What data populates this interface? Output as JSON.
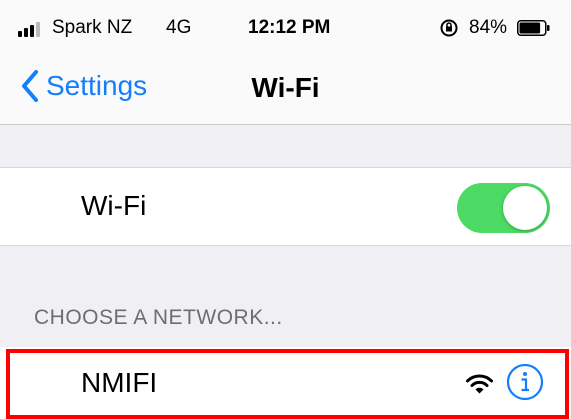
{
  "status_bar": {
    "carrier": "Spark NZ",
    "network_type": "4G",
    "time": "12:12 PM",
    "battery_percent": "84%",
    "battery_level": 0.84,
    "signal_bars": 3
  },
  "nav": {
    "back_label": "Settings",
    "title": "Wi-Fi"
  },
  "wifi_toggle": {
    "label": "Wi-Fi",
    "enabled": true
  },
  "networks_section": {
    "header": "CHOOSE A NETWORK...",
    "networks": [
      {
        "name": "NMIFI",
        "highlighted": true
      }
    ]
  },
  "colors": {
    "accent": "#147efb",
    "toggle_on": "#4cd964",
    "highlight": "#ff0000",
    "background": "#efeff4"
  }
}
